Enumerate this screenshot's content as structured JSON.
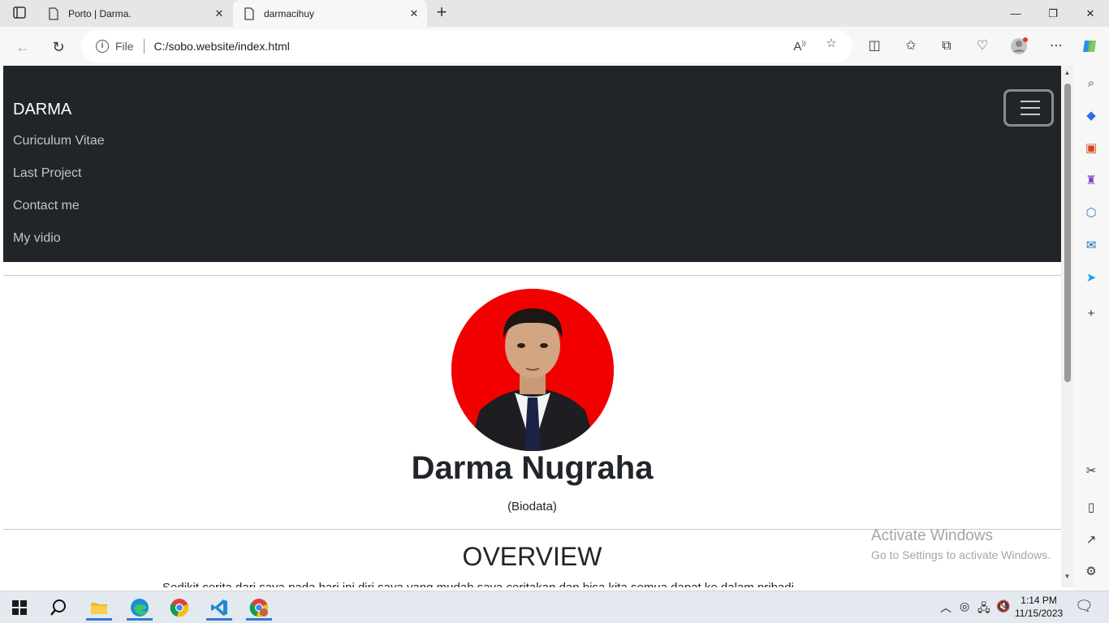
{
  "browser": {
    "tabs": [
      {
        "title": "Porto | Darma.",
        "active": false
      },
      {
        "title": "darmacihuy",
        "active": true
      }
    ],
    "address": {
      "scheme_label": "File",
      "url": "C:/sobo.website/index.html"
    }
  },
  "page": {
    "brand": "DARMA",
    "nav_links": [
      "Curiculum Vitae",
      "Last Project",
      "Contact me",
      "My vidio"
    ],
    "profile_name": "Darma Nugraha",
    "profile_subtitle": "(Biodata)",
    "section_heading": "OVERVIEW",
    "section_text_partial": "Sedikit cerita dari saya pada hari ini diri saya yang mudah saya ceritakan dan bisa kita semua dapat ke dalam pribadi."
  },
  "watermark": {
    "line1": "Activate Windows",
    "line2": "Go to Settings to activate Windows."
  },
  "taskbar": {
    "time": "1:14 PM",
    "date": "11/15/2023"
  },
  "colors": {
    "navbar_bg": "#212529",
    "avatar_bg": "#f20000",
    "accent": "#2f7cd6"
  }
}
